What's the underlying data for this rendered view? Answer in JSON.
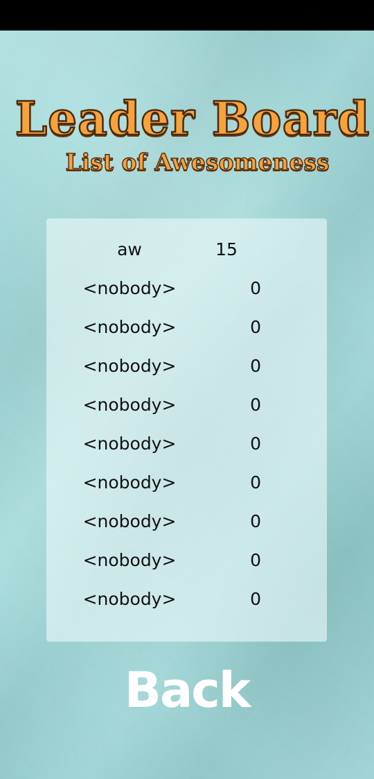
{
  "header": {
    "title": "Leader Board",
    "subtitle": "List of Awesomeness"
  },
  "leaderboard": {
    "rows": [
      {
        "name": "aw",
        "score": "15"
      },
      {
        "name": "<nobody>",
        "score": "0"
      },
      {
        "name": "<nobody>",
        "score": "0"
      },
      {
        "name": "<nobody>",
        "score": "0"
      },
      {
        "name": "<nobody>",
        "score": "0"
      },
      {
        "name": "<nobody>",
        "score": "0"
      },
      {
        "name": "<nobody>",
        "score": "0"
      },
      {
        "name": "<nobody>",
        "score": "0"
      },
      {
        "name": "<nobody>",
        "score": "0"
      },
      {
        "name": "<nobody>",
        "score": "0"
      }
    ]
  },
  "footer": {
    "back_label": "Back"
  },
  "colors": {
    "background": "#9fd9d9",
    "title": "#f8a23b",
    "title_outline": "#4a2a10",
    "back_text": "#ffffff"
  }
}
